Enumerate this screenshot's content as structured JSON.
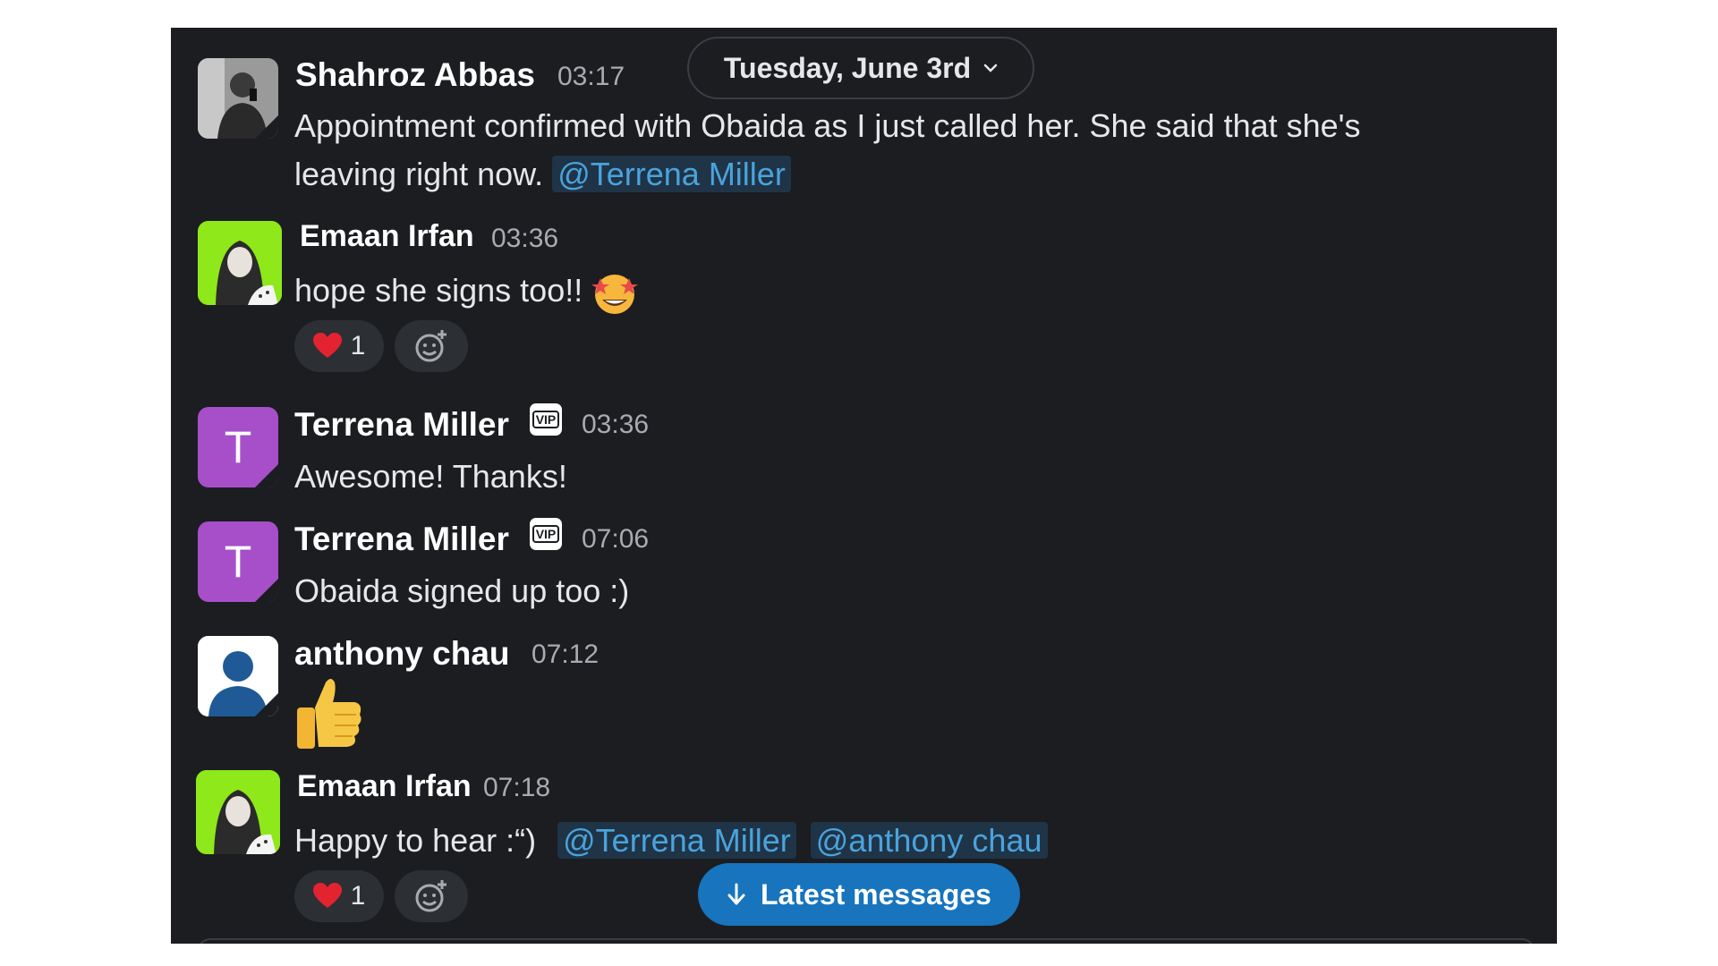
{
  "date_divider": {
    "label": "Tuesday, June 3rd"
  },
  "messages": [
    {
      "author": "Shahroz Abbas",
      "time": "03:17",
      "line1": "Appointment confirmed with Obaida as I just called her. She said that she's",
      "line2": "leaving right now.",
      "mention": "@Terrena Miller"
    },
    {
      "author": "Emaan Irfan",
      "time": "03:36",
      "text": "hope she signs too!!",
      "reaction_count": "1"
    },
    {
      "author": "Terrena Miller",
      "badge": "VIP",
      "time": "03:36",
      "text": "Awesome! Thanks!",
      "avatar_letter": "T"
    },
    {
      "author": "Terrena Miller",
      "badge": "VIP",
      "time": "07:06",
      "text": "Obaida signed up too :)",
      "avatar_letter": "T"
    },
    {
      "author": "anthony chau",
      "time": "07:12",
      "text": ""
    },
    {
      "author": "Emaan Irfan",
      "time": "07:18",
      "text": "Happy to hear :“)",
      "mentions": [
        "@Terrena Miller",
        "@anthony chau"
      ],
      "reaction_count": "1"
    }
  ],
  "latest_button": {
    "label": "Latest messages"
  },
  "colors": {
    "background": "#1b1d21",
    "mention": "#4aa3dc",
    "button": "#1774bd",
    "avatar_purple": "#a64fc8",
    "avatar_green": "#8ee81a"
  },
  "icons": [
    "chevron-down-icon",
    "heart-icon",
    "add-reaction-icon",
    "star-struck-emoji",
    "thumbs-up-emoji",
    "arrow-down-icon",
    "user-icon"
  ]
}
